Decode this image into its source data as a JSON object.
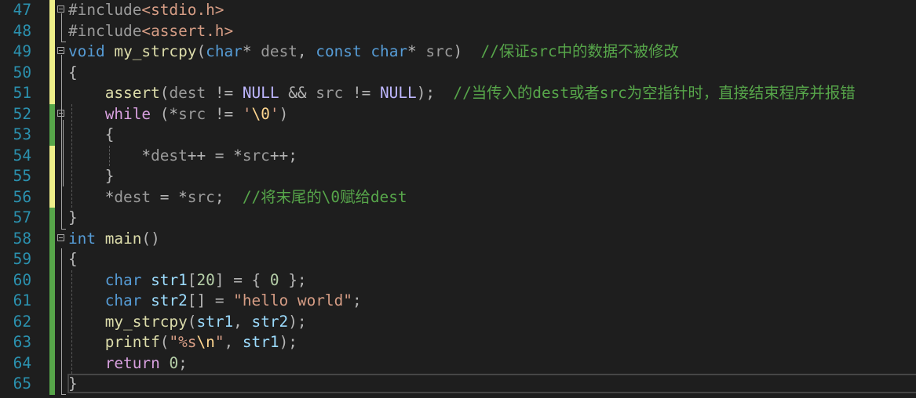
{
  "editor": {
    "colors": {
      "added_saved": "#57a64a",
      "added_unsaved": "#eff08a",
      "line_number": "#2b91af"
    },
    "lines": [
      {
        "num": "47",
        "change": "unsaved",
        "fold": true,
        "tokens": [
          [
            "pp",
            "#include"
          ],
          [
            "s",
            "<stdio.h>"
          ]
        ]
      },
      {
        "num": "48",
        "change": "unsaved",
        "fold": false,
        "tokens": [
          [
            "pp",
            "#include"
          ],
          [
            "s",
            "<assert.h>"
          ]
        ]
      },
      {
        "num": "49",
        "change": "unsaved",
        "fold": true,
        "tokens": [
          [
            "k",
            "void"
          ],
          [
            "o",
            " "
          ],
          [
            "f",
            "my_strcpy"
          ],
          [
            "o",
            "("
          ],
          [
            "k",
            "char"
          ],
          [
            "o",
            "* "
          ],
          [
            "p",
            "dest"
          ],
          [
            "o",
            ", "
          ],
          [
            "k",
            "const"
          ],
          [
            "o",
            " "
          ],
          [
            "k",
            "char"
          ],
          [
            "o",
            "* "
          ],
          [
            "p",
            "src"
          ],
          [
            "o",
            ")  "
          ],
          [
            "g",
            "//保证src中的数据不被修改"
          ]
        ]
      },
      {
        "num": "50",
        "change": "unsaved",
        "fold": false,
        "tokens": [
          [
            "o",
            "{"
          ]
        ]
      },
      {
        "num": "51",
        "change": "unsaved",
        "fold": false,
        "tokens": [
          [
            "o",
            "    "
          ],
          [
            "f",
            "assert"
          ],
          [
            "o",
            "("
          ],
          [
            "p",
            "dest"
          ],
          [
            "o",
            " != "
          ],
          [
            "m",
            "NULL"
          ],
          [
            "o",
            " && "
          ],
          [
            "p",
            "src"
          ],
          [
            "o",
            " != "
          ],
          [
            "m",
            "NULL"
          ],
          [
            "o",
            ");  "
          ],
          [
            "g",
            "//当传入的dest或者src为空指针时，直接结束程序并报错"
          ]
        ]
      },
      {
        "num": "52",
        "change": "saved",
        "fold": true,
        "tokens": [
          [
            "o",
            "    "
          ],
          [
            "c",
            "while"
          ],
          [
            "o",
            " (*"
          ],
          [
            "p",
            "src"
          ],
          [
            "o",
            " != "
          ],
          [
            "s",
            "'"
          ],
          [
            "e",
            "\\0"
          ],
          [
            "s",
            "'"
          ],
          [
            "o",
            ")"
          ]
        ]
      },
      {
        "num": "53",
        "change": "saved",
        "fold": false,
        "tokens": [
          [
            "o",
            "    {"
          ]
        ]
      },
      {
        "num": "54",
        "change": "unsaved",
        "fold": false,
        "tokens": [
          [
            "o",
            "        *"
          ],
          [
            "p",
            "dest"
          ],
          [
            "o",
            "++ = *"
          ],
          [
            "p",
            "src"
          ],
          [
            "o",
            "++;"
          ]
        ]
      },
      {
        "num": "55",
        "change": "unsaved",
        "fold": false,
        "tokens": [
          [
            "o",
            "    }"
          ]
        ]
      },
      {
        "num": "56",
        "change": "unsaved",
        "fold": false,
        "tokens": [
          [
            "o",
            "    *"
          ],
          [
            "p",
            "dest"
          ],
          [
            "o",
            " = *"
          ],
          [
            "p",
            "src"
          ],
          [
            "o",
            ";  "
          ],
          [
            "g",
            "//将末尾的\\0赋给dest"
          ]
        ]
      },
      {
        "num": "57",
        "change": "saved",
        "fold": false,
        "tokens": [
          [
            "o",
            "}"
          ]
        ]
      },
      {
        "num": "58",
        "change": "saved",
        "fold": true,
        "tokens": [
          [
            "k",
            "int"
          ],
          [
            "o",
            " "
          ],
          [
            "f",
            "main"
          ],
          [
            "o",
            "()"
          ]
        ]
      },
      {
        "num": "59",
        "change": "saved",
        "fold": false,
        "tokens": [
          [
            "o",
            "{"
          ]
        ]
      },
      {
        "num": "60",
        "change": "saved",
        "fold": false,
        "tokens": [
          [
            "o",
            "    "
          ],
          [
            "k",
            "char"
          ],
          [
            "o",
            " "
          ],
          [
            "v",
            "str1"
          ],
          [
            "o",
            "["
          ],
          [
            "n",
            "20"
          ],
          [
            "o",
            "] = { "
          ],
          [
            "n",
            "0"
          ],
          [
            "o",
            " };"
          ]
        ]
      },
      {
        "num": "61",
        "change": "saved",
        "fold": false,
        "tokens": [
          [
            "o",
            "    "
          ],
          [
            "k",
            "char"
          ],
          [
            "o",
            " "
          ],
          [
            "v",
            "str2"
          ],
          [
            "o",
            "[] = "
          ],
          [
            "s",
            "\"hello world\""
          ],
          [
            "o",
            ";"
          ]
        ]
      },
      {
        "num": "62",
        "change": "saved",
        "fold": false,
        "tokens": [
          [
            "o",
            "    "
          ],
          [
            "f",
            "my_strcpy"
          ],
          [
            "o",
            "("
          ],
          [
            "v",
            "str1"
          ],
          [
            "o",
            ", "
          ],
          [
            "v",
            "str2"
          ],
          [
            "o",
            ");"
          ]
        ]
      },
      {
        "num": "63",
        "change": "saved",
        "fold": false,
        "tokens": [
          [
            "o",
            "    "
          ],
          [
            "f",
            "printf"
          ],
          [
            "o",
            "("
          ],
          [
            "s",
            "\"%s"
          ],
          [
            "e",
            "\\n"
          ],
          [
            "s",
            "\""
          ],
          [
            "o",
            ", "
          ],
          [
            "v",
            "str1"
          ],
          [
            "o",
            ");"
          ]
        ]
      },
      {
        "num": "64",
        "change": "saved",
        "fold": false,
        "tokens": [
          [
            "o",
            "    "
          ],
          [
            "c",
            "return"
          ],
          [
            "o",
            " "
          ],
          [
            "n",
            "0"
          ],
          [
            "o",
            ";"
          ]
        ]
      },
      {
        "num": "65",
        "change": "saved",
        "fold": false,
        "tokens": [
          [
            "o",
            "}"
          ]
        ]
      }
    ]
  }
}
